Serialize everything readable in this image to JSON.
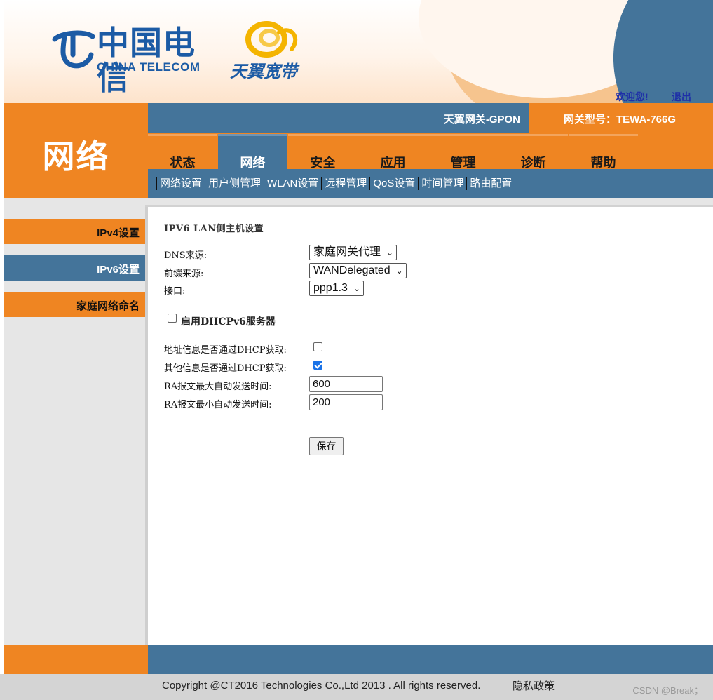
{
  "header": {
    "brand_cn": "中国电信",
    "brand_en": "CHINA TELECOM",
    "product_logo_text": "天翼宽带",
    "welcome": "欢迎您!",
    "logout": "退出"
  },
  "section_title": "网络",
  "device": {
    "name": "天翼网关-GPON",
    "model": "网关型号：TEWA-766G"
  },
  "tabs": [
    {
      "label": "状态",
      "active": false
    },
    {
      "label": "网络",
      "active": true
    },
    {
      "label": "安全",
      "active": false
    },
    {
      "label": "应用",
      "active": false
    },
    {
      "label": "管理",
      "active": false
    },
    {
      "label": "诊断",
      "active": false
    },
    {
      "label": "帮助",
      "active": false
    }
  ],
  "subnav": [
    {
      "label": "网络设置",
      "active": false
    },
    {
      "label": "用户侧管理",
      "active": true
    },
    {
      "label": "WLAN设置",
      "active": false
    },
    {
      "label": "远程管理",
      "active": false
    },
    {
      "label": "QoS设置",
      "active": false
    },
    {
      "label": "时间管理",
      "active": false
    },
    {
      "label": "路由配置",
      "active": false
    }
  ],
  "sidebar": [
    {
      "label": "IPv4设置",
      "active": false
    },
    {
      "label": "IPv6设置",
      "active": true
    },
    {
      "label": "家庭网络命名",
      "active": false
    }
  ],
  "form": {
    "title": "IPV6 LAN侧主机设置",
    "dns_source_label": "DNS来源:",
    "dns_source_value": "家庭网关代理",
    "prefix_source_label": "前缀来源:",
    "prefix_source_value": "WANDelegated",
    "interface_label": "接口:",
    "interface_value": "ppp1.3",
    "enable_dhcpv6_label": "启用DHCPv6服务器",
    "enable_dhcpv6_checked": false,
    "addr_via_dhcp_label": "地址信息是否通过DHCP获取:",
    "addr_via_dhcp_checked": false,
    "other_via_dhcp_label": "其他信息是否通过DHCP获取:",
    "other_via_dhcp_checked": true,
    "ra_max_label": "RA报文最大自动发送时间:",
    "ra_max_value": "600",
    "ra_min_label": "RA报文最小自动发送时间:",
    "ra_min_value": "200",
    "save_label": "保存"
  },
  "footer": {
    "copyright": "Copyright @CT2016 Technologies Co.,Ltd 2013 . All rights reserved.",
    "privacy": "隐私政策",
    "watermark": "CSDN @Break；"
  },
  "colors": {
    "orange": "#ef8522",
    "steel_blue": "#44749a",
    "brand_blue": "#1c5ba5",
    "sidebar_grey": "#e6e6e6"
  }
}
